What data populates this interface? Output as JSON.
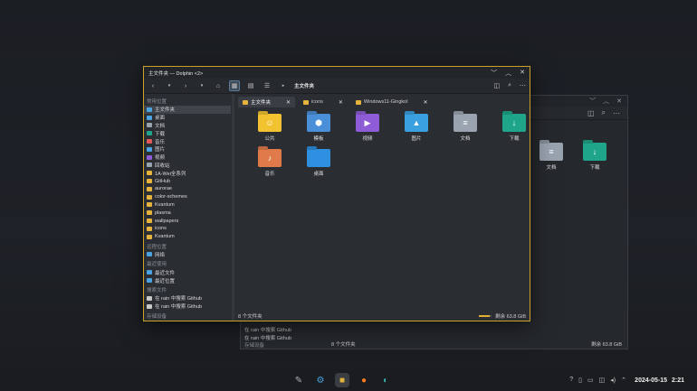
{
  "main_window": {
    "title": "主文件夹 — Dolphin <2>",
    "breadcrumb": "主文件夹",
    "tabs": [
      {
        "label": "主文件夹",
        "active": true
      },
      {
        "label": "icons",
        "active": false
      },
      {
        "label": "Windows11-Gingkol",
        "active": false
      }
    ],
    "sidebar": {
      "places_title": "常用位置",
      "places": [
        "主文件夹",
        "桌面",
        "文档",
        "下载",
        "音乐",
        "图片",
        "视频",
        "回收站",
        "1A-Wei全系列",
        "GitHub",
        "aurorae",
        "color-schemes",
        "Kvantum",
        "plasma",
        "wallpapers",
        "icons",
        "Kvantum"
      ],
      "remote_title": "远程位置",
      "remote": [
        "网络"
      ],
      "recent_title": "最近使用",
      "recent": [
        "最近文件",
        "最近位置"
      ],
      "search_title": "搜索文件",
      "search": [
        "在 rain 中搜索 Github",
        "在 rain 中搜索 Github"
      ],
      "devices_title": "存储设备"
    },
    "items": [
      {
        "label": "公共",
        "color": "#f2c230",
        "glyph": "☺"
      },
      {
        "label": "模板",
        "color": "#4a90d9",
        "glyph": "⬢"
      },
      {
        "label": "视频",
        "color": "#8e5cd6",
        "glyph": "▶"
      },
      {
        "label": "图片",
        "color": "#3aa0e0",
        "glyph": "▲"
      },
      {
        "label": "文档",
        "color": "#9aa4b0",
        "glyph": "≡"
      },
      {
        "label": "下载",
        "color": "#1fa68a",
        "glyph": "↓"
      },
      {
        "label": "音乐",
        "color": "#e07a4a",
        "glyph": "♪"
      },
      {
        "label": "桌面",
        "color": "#2f8fe0",
        "glyph": ""
      }
    ],
    "status": {
      "count": "8 个文件夹",
      "free": "剩余 63.8 GiB",
      "used_fraction": 0.85
    }
  },
  "back_window": {
    "items": [
      {
        "label": "文档",
        "color": "#9aa4b0",
        "glyph": "≡"
      },
      {
        "label": "下载",
        "color": "#1fa68a",
        "glyph": "↓"
      }
    ],
    "recent": [
      "在 rain 中搜索 Github",
      "在 rain 中搜索 Github",
      "存储设备"
    ],
    "status": {
      "count": "8 个文件夹",
      "free": "剩余 63.8 GiB"
    }
  },
  "taskbar": {
    "date": "2024-05-15",
    "time": "2:21"
  }
}
